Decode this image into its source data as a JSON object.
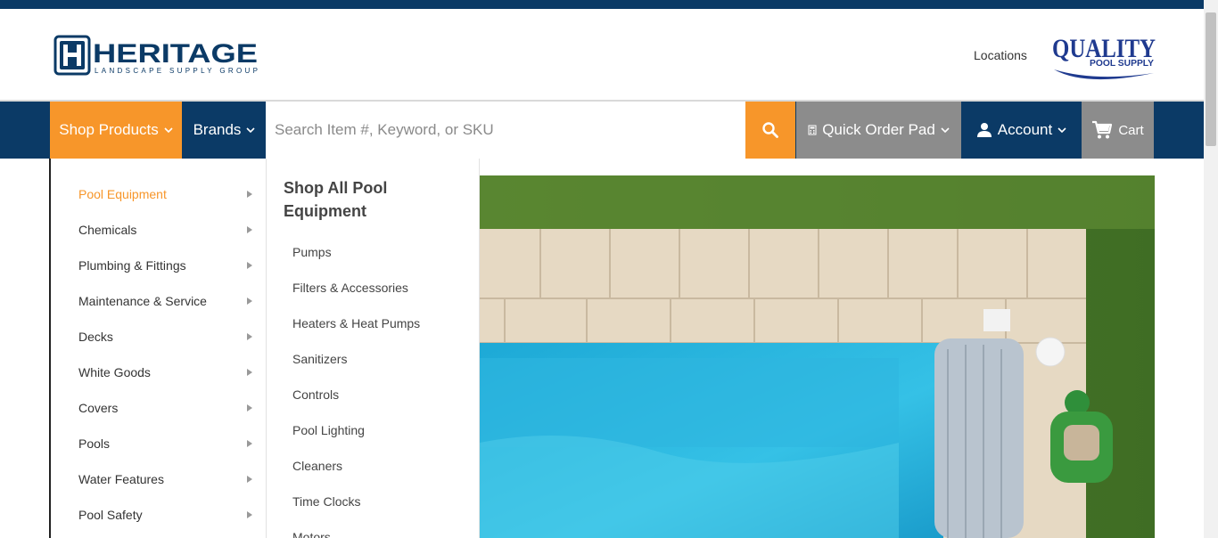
{
  "header": {
    "brand_name": "HERITAGE",
    "brand_tagline": "LANDSCAPE SUPPLY GROUP",
    "locations_label": "Locations",
    "partner_logo_line1": "QUALITY",
    "partner_logo_line2": "POOL SUPPLY"
  },
  "nav": {
    "shop_products": "Shop Products",
    "brands": "Brands",
    "search_placeholder": "Search Item #, Keyword, or SKU",
    "quick_order": "Quick Order Pad",
    "account": "Account",
    "cart": "Cart"
  },
  "menu": {
    "categories": [
      {
        "label": "Pool Equipment",
        "active": true
      },
      {
        "label": "Chemicals"
      },
      {
        "label": "Plumbing & Fittings"
      },
      {
        "label": "Maintenance & Service"
      },
      {
        "label": "Decks"
      },
      {
        "label": "White Goods"
      },
      {
        "label": "Covers"
      },
      {
        "label": "Pools"
      },
      {
        "label": "Water Features"
      },
      {
        "label": "Pool Safety"
      }
    ],
    "sub_title": "Shop All Pool Equipment",
    "sub_items": [
      "Pumps",
      "Filters & Accessories",
      "Heaters & Heat Pumps",
      "Sanitizers",
      "Controls",
      "Pool Lighting",
      "Cleaners",
      "Time Clocks",
      "Motors"
    ]
  },
  "colors": {
    "navy": "#0b3a66",
    "orange": "#f7962a",
    "gray_nav": "#8c8c8c"
  },
  "icons": [
    "search-icon",
    "chevron-down-icon",
    "calculator-icon",
    "user-icon",
    "cart-icon",
    "caret-right-icon"
  ]
}
